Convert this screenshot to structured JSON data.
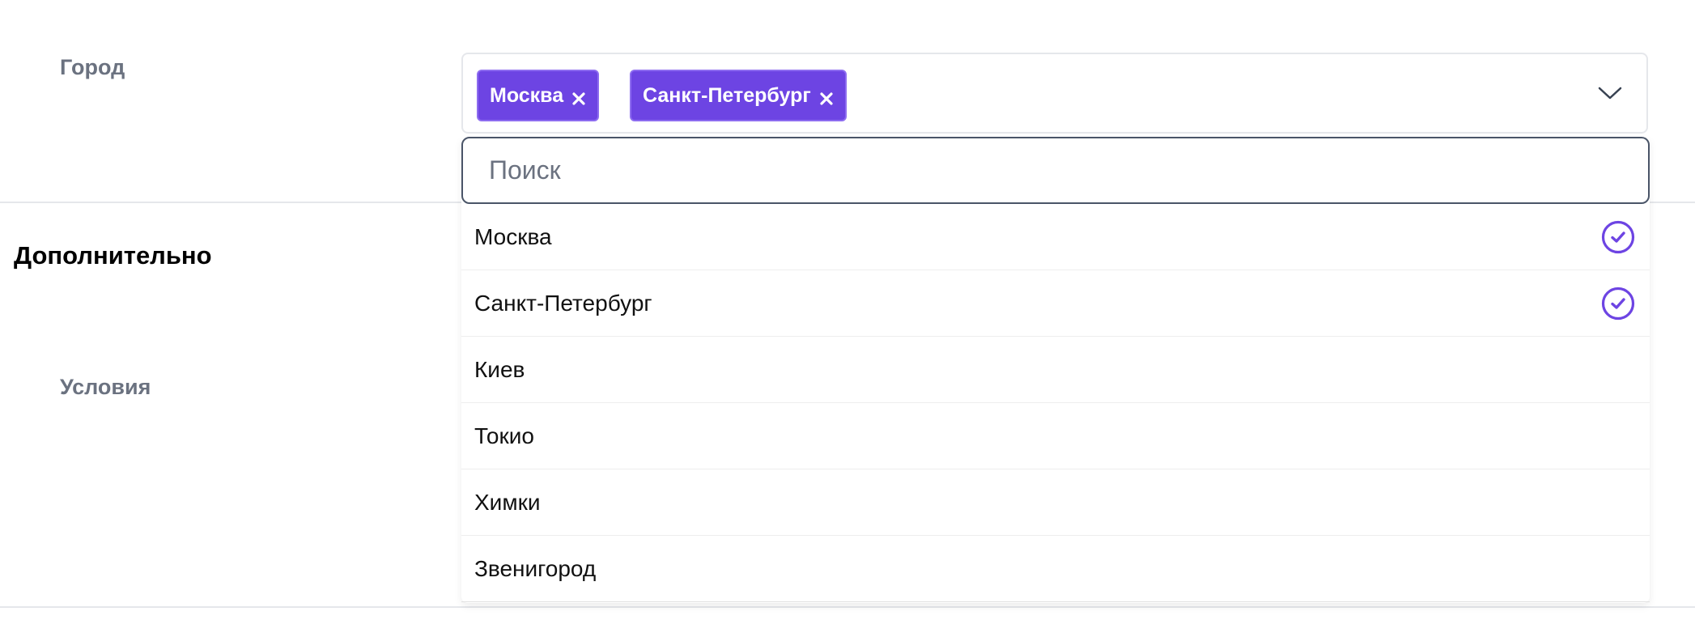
{
  "form": {
    "city_label": "Город",
    "section_title": "Дополнительно",
    "conditions_label": "Условия"
  },
  "select": {
    "selected_tags": [
      {
        "label": "Москва",
        "icon": "close-icon"
      },
      {
        "label": "Санкт-Петербург",
        "icon": "close-icon"
      }
    ],
    "toggle_icon": "chevron-down-icon",
    "search_placeholder": "Поиск",
    "search_value": "",
    "options": [
      {
        "label": "Москва",
        "selected": true
      },
      {
        "label": "Санкт-Петербург",
        "selected": true
      },
      {
        "label": "Киев",
        "selected": false
      },
      {
        "label": "Токио",
        "selected": false
      },
      {
        "label": "Химки",
        "selected": false
      },
      {
        "label": "Звенигород",
        "selected": false
      }
    ]
  },
  "colors": {
    "accent": "#6d44e3",
    "label": "#6b7280",
    "divider": "#e5e7eb"
  }
}
